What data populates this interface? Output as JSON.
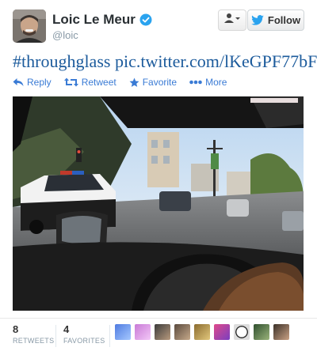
{
  "user": {
    "fullname": "Loic Le Meur",
    "handle": "@loic",
    "verified_icon": "verified-badge-icon"
  },
  "header": {
    "user_menu_icon": "person-dropdown-icon",
    "follow_label": "Follow",
    "follow_icon": "twitter-bird-icon"
  },
  "tweet": {
    "hashtag": "#throughglass",
    "link": "pic.twitter.com/lKeGPF77bF"
  },
  "actions": [
    {
      "label": "Reply",
      "icon": "reply-icon"
    },
    {
      "label": "Retweet",
      "icon": "retweet-icon"
    },
    {
      "label": "Favorite",
      "icon": "star-icon"
    },
    {
      "label": "More",
      "icon": "more-dots-icon"
    }
  ],
  "stats": {
    "retweets_count": "8",
    "retweets_label": "RETWEETS",
    "favorites_count": "4",
    "favorites_label": "FAVORITES"
  },
  "favoriter_avatars": [
    "avatar-1",
    "avatar-2",
    "avatar-3",
    "avatar-4",
    "avatar-5",
    "avatar-6",
    "avatar-7",
    "avatar-8",
    "avatar-9"
  ],
  "colors": {
    "link": "#1c5b9c",
    "action": "#3a7bd5",
    "verified": "#2aa3ef"
  }
}
